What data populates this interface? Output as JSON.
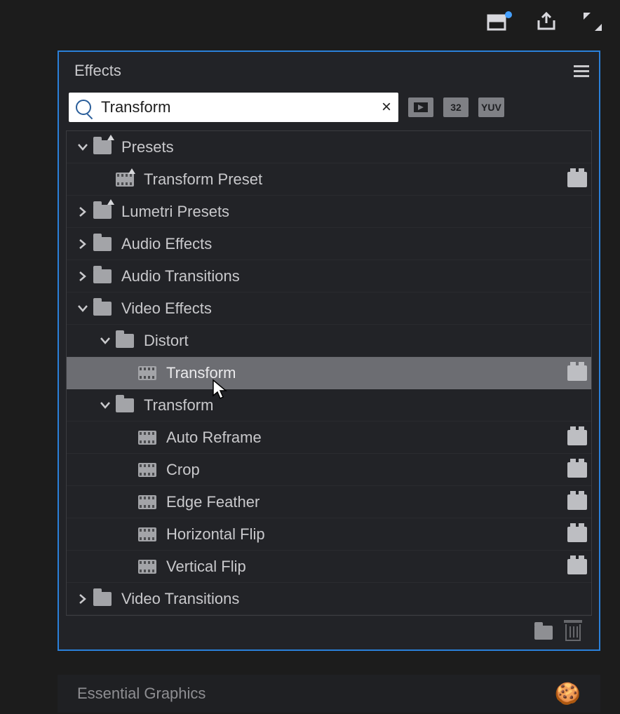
{
  "header": {
    "panel_title": "Effects"
  },
  "search": {
    "value": "Transform"
  },
  "filter_badges": {
    "b2": "32",
    "b3": "YUV"
  },
  "tree": [
    {
      "depth": 0,
      "expanded": true,
      "icon": "folder-star",
      "label": "Presets"
    },
    {
      "depth": 1,
      "leaf": true,
      "icon": "film-star",
      "label": "Transform Preset",
      "accel": true
    },
    {
      "depth": 0,
      "expanded": false,
      "icon": "folder-star",
      "label": "Lumetri Presets"
    },
    {
      "depth": 0,
      "expanded": false,
      "icon": "folder",
      "label": "Audio Effects"
    },
    {
      "depth": 0,
      "expanded": false,
      "icon": "folder",
      "label": "Audio Transitions"
    },
    {
      "depth": 0,
      "expanded": true,
      "icon": "folder",
      "label": "Video Effects"
    },
    {
      "depth": 1,
      "expanded": true,
      "icon": "folder",
      "label": "Distort"
    },
    {
      "depth": 2,
      "leaf": true,
      "icon": "film",
      "label": "Transform",
      "accel": true,
      "selected": true
    },
    {
      "depth": 1,
      "expanded": true,
      "icon": "folder",
      "label": "Transform"
    },
    {
      "depth": 2,
      "leaf": true,
      "icon": "film",
      "label": "Auto Reframe",
      "accel": true
    },
    {
      "depth": 2,
      "leaf": true,
      "icon": "film",
      "label": "Crop",
      "accel": true
    },
    {
      "depth": 2,
      "leaf": true,
      "icon": "film",
      "label": "Edge Feather",
      "accel": true
    },
    {
      "depth": 2,
      "leaf": true,
      "icon": "film",
      "label": "Horizontal Flip",
      "accel": true
    },
    {
      "depth": 2,
      "leaf": true,
      "icon": "film",
      "label": "Vertical Flip",
      "accel": true
    },
    {
      "depth": 0,
      "expanded": false,
      "icon": "folder",
      "label": "Video Transitions"
    }
  ],
  "bottom": {
    "title": "Essential Graphics"
  }
}
